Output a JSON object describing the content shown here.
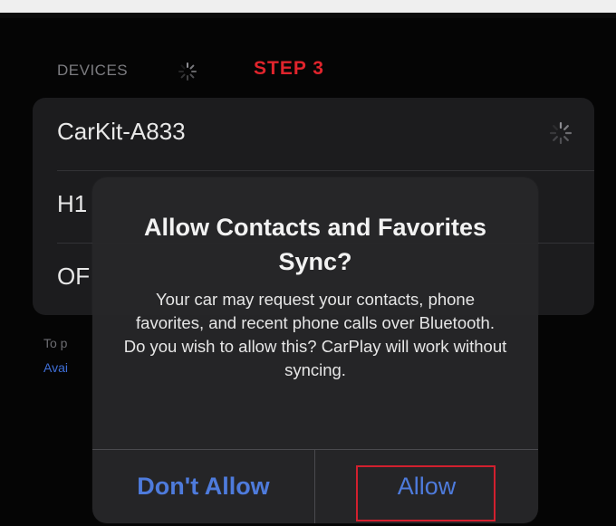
{
  "section": {
    "header": "DEVICES",
    "step_label": "STEP 3"
  },
  "devices": [
    {
      "name": "CarKit-A833",
      "status": "spinner-icon"
    },
    {
      "name": "H1",
      "status": ""
    },
    {
      "name": "OF",
      "status": ""
    }
  ],
  "footer": {
    "text": "To p",
    "link": "Avai"
  },
  "alert": {
    "title": "Allow Contacts and Favorites Sync?",
    "message": "Your car may request your contacts, phone favorites, and recent phone calls over Bluetooth. Do you wish to allow this? CarPlay will work without syncing.",
    "dont_allow_label": "Don't Allow",
    "allow_label": "Allow"
  },
  "colors": {
    "accent_blue": "#4e7bdc",
    "step_red": "#e0242c",
    "highlight_red": "#d2202e",
    "card_bg": "#1c1c1e",
    "alert_bg": "#262629"
  }
}
